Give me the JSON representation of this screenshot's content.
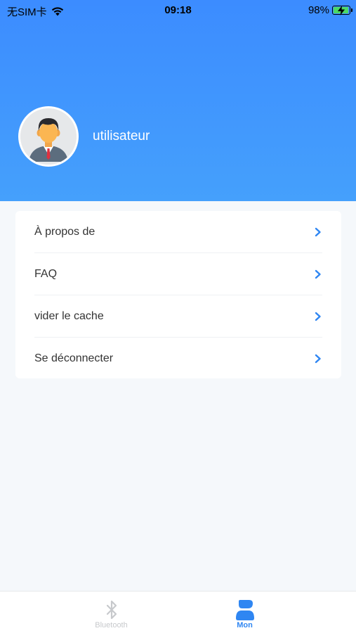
{
  "status_bar": {
    "carrier": "无SIM卡",
    "time": "09:18",
    "battery_percent": "98%",
    "battery_level": 0.98
  },
  "profile": {
    "username": "utilisateur"
  },
  "menu": {
    "items": [
      {
        "label": "À propos de"
      },
      {
        "label": "FAQ"
      },
      {
        "label": "vider le cache"
      },
      {
        "label": "Se déconnecter"
      }
    ]
  },
  "tab_bar": {
    "tabs": [
      {
        "label": "Bluetooth",
        "icon": "bluetooth-icon",
        "active": false
      },
      {
        "label": "Mon",
        "icon": "user-icon",
        "active": true
      }
    ]
  },
  "colors": {
    "header_gradient_start": "#3c8cff",
    "header_gradient_end": "#45a0fc",
    "accent": "#2f86f2",
    "background": "#f5f8fb"
  }
}
